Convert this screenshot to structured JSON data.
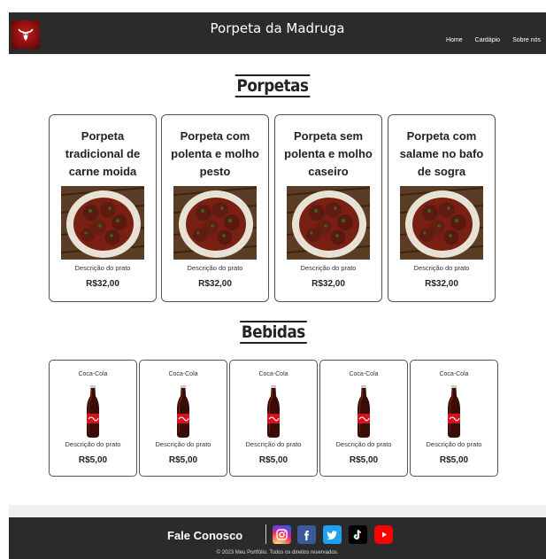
{
  "header": {
    "title": "Porpeta da Madruga",
    "nav": [
      "Home",
      "Cardápio",
      "Sobre nós"
    ]
  },
  "sections": {
    "food_title": "Porpetas",
    "drinks_title": "Bebidas"
  },
  "foods": [
    {
      "name": "Porpeta tradicional de carne moida",
      "desc": "Descrição do prato",
      "price": "R$32,00"
    },
    {
      "name": "Porpeta com polenta e molho pesto",
      "desc": "Descrição do prato",
      "price": "R$32,00"
    },
    {
      "name": "Porpeta sem polenta e molho caseiro",
      "desc": "Descrição do prato",
      "price": "R$32,00"
    },
    {
      "name": "Porpeta com salame no bafo de sogra",
      "desc": "Descrição do prato",
      "price": "R$32,00"
    }
  ],
  "drinks": [
    {
      "name": "Coca-Cola",
      "desc": "Descrição do prato",
      "price": "R$5,00"
    },
    {
      "name": "Coca-Cola",
      "desc": "Descrição do prato",
      "price": "R$5,00"
    },
    {
      "name": "Coca-Cola",
      "desc": "Descrição do prato",
      "price": "R$5,00"
    },
    {
      "name": "Coca-Cola",
      "desc": "Descrição do prato",
      "price": "R$5,00"
    },
    {
      "name": "Coca-Cola",
      "desc": "Descrição do prato",
      "price": "R$5,00"
    }
  ],
  "footer": {
    "contact": "Fale Conosco",
    "social": [
      "instagram-icon",
      "facebook-icon",
      "twitter-icon",
      "tiktok-icon",
      "youtube-icon"
    ],
    "copyright": "© 2023 Meu Portfólio. Todos os direitos reservados."
  },
  "colors": {
    "header_bg": "#2b2b2b",
    "instagram": "#e1306c",
    "facebook": "#3b5998",
    "twitter": "#1da1f2",
    "tiktok": "#000000",
    "youtube": "#ff0000"
  }
}
